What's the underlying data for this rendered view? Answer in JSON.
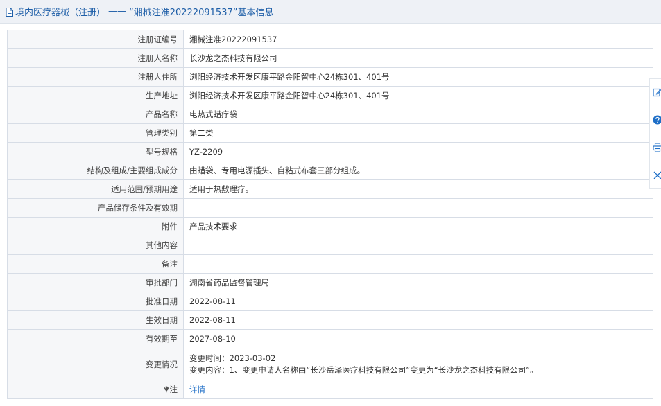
{
  "header": {
    "breadcrumb_link": "境内医疗器械（注册）",
    "separator": "——",
    "page_title": "“湘械注准20222091537”基本信息"
  },
  "rows": [
    {
      "label": "注册证编号",
      "value": "湘械注准20222091537"
    },
    {
      "label": "注册人名称",
      "value": "长沙龙之杰科技有限公司"
    },
    {
      "label": "注册人住所",
      "value": "浏阳经济技术开发区康平路金阳智中心24栋301、401号"
    },
    {
      "label": "生产地址",
      "value": "浏阳经济技术开发区康平路金阳智中心24栋301、401号"
    },
    {
      "label": "产品名称",
      "value": "电热式蜡疗袋"
    },
    {
      "label": "管理类别",
      "value": "第二类"
    },
    {
      "label": "型号规格",
      "value": "YZ-2209"
    },
    {
      "label": "结构及组成/主要组成成分",
      "value": "由蜡袋、专用电源插头、自粘式布套三部分组成。"
    },
    {
      "label": "适用范围/预期用途",
      "value": "适用于热敷理疗。"
    },
    {
      "label": "产品储存条件及有效期",
      "value": ""
    },
    {
      "label": "附件",
      "value": "产品技术要求"
    },
    {
      "label": "其他内容",
      "value": ""
    },
    {
      "label": "备注",
      "value": ""
    },
    {
      "label": "审批部门",
      "value": "湖南省药品监督管理局"
    },
    {
      "label": "批准日期",
      "value": "2022-08-11"
    },
    {
      "label": "生效日期",
      "value": "2022-08-11"
    },
    {
      "label": "有效期至",
      "value": "2027-08-10"
    }
  ],
  "change": {
    "label": "变更情况",
    "line1": "变更时间：2023-03-02",
    "line2": "变更内容：1、变更申请人名称由“长沙岳泽医疗科技有限公司”变更为“长沙龙之杰科技有限公司”。"
  },
  "note": {
    "label": "注",
    "link": "详情"
  },
  "icons": {
    "header": "document-icon",
    "note": "pin-icon",
    "tools": [
      "edit-icon",
      "help-icon",
      "print-icon",
      "close-icon"
    ]
  },
  "colors": {
    "link": "#1f5fa8",
    "header_bg": "#eef1f6",
    "label_bg": "#f6f7f9",
    "border": "#d7dde6"
  }
}
